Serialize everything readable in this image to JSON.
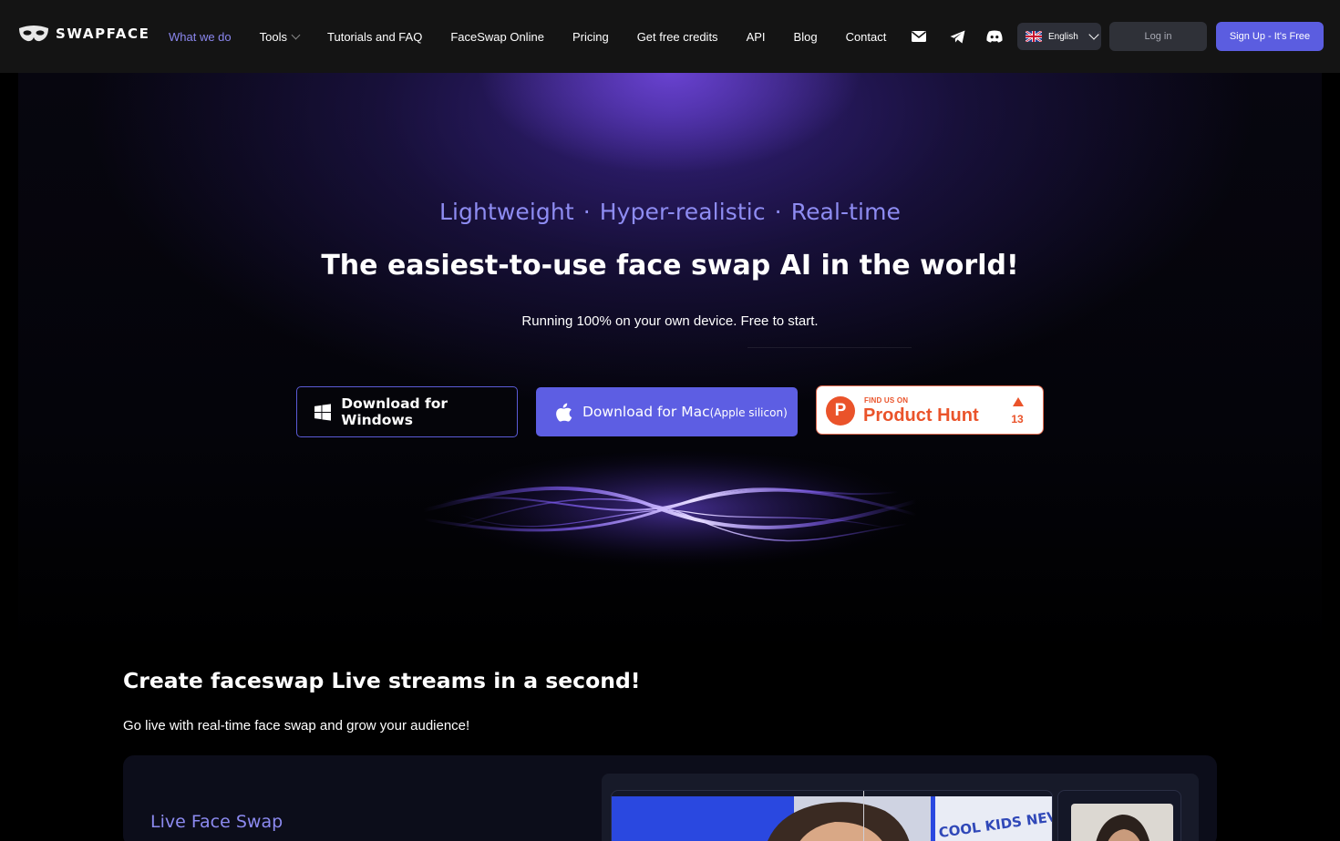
{
  "brand": {
    "name": "SWAPFACE",
    "accent": "#5b5de0",
    "accent_text": "#8e8cf2"
  },
  "nav": {
    "links": [
      {
        "label": "What we do",
        "active": true
      },
      {
        "label": "Tools",
        "dropdown": true
      },
      {
        "label": "Tutorials and FAQ"
      },
      {
        "label": "FaceSwap Online"
      },
      {
        "label": "Pricing"
      },
      {
        "label": "Get free credits"
      },
      {
        "label": "API"
      },
      {
        "label": "Blog"
      },
      {
        "label": "Contact"
      }
    ],
    "icons": [
      "mail-icon",
      "telegram-icon",
      "discord-icon"
    ],
    "language": "English",
    "login": "Log in",
    "signup": "Sign Up - It's Free"
  },
  "hero": {
    "tagline": [
      "Lightweight",
      "Hyper-realistic",
      "Real-time"
    ],
    "tagline_sep": "·",
    "headline": "The easiest-to-use face swap AI in the world!",
    "subhead": "Running 100% on your own device. Free to start.",
    "download_windows": "Download for Windows",
    "download_mac": "Download for Mac",
    "download_mac_note": "(Apple silicon)",
    "product_hunt": {
      "kicker": "FIND US ON",
      "name": "Product Hunt",
      "votes": "13",
      "color": "#ea532a"
    }
  },
  "section": {
    "title": "Create faceswap Live streams in a second!",
    "subtitle": "Go live with real-time face swap and grow your audience!",
    "card_title": "Live Face Swap",
    "sign_text": "COOL KIDS NEVER"
  }
}
